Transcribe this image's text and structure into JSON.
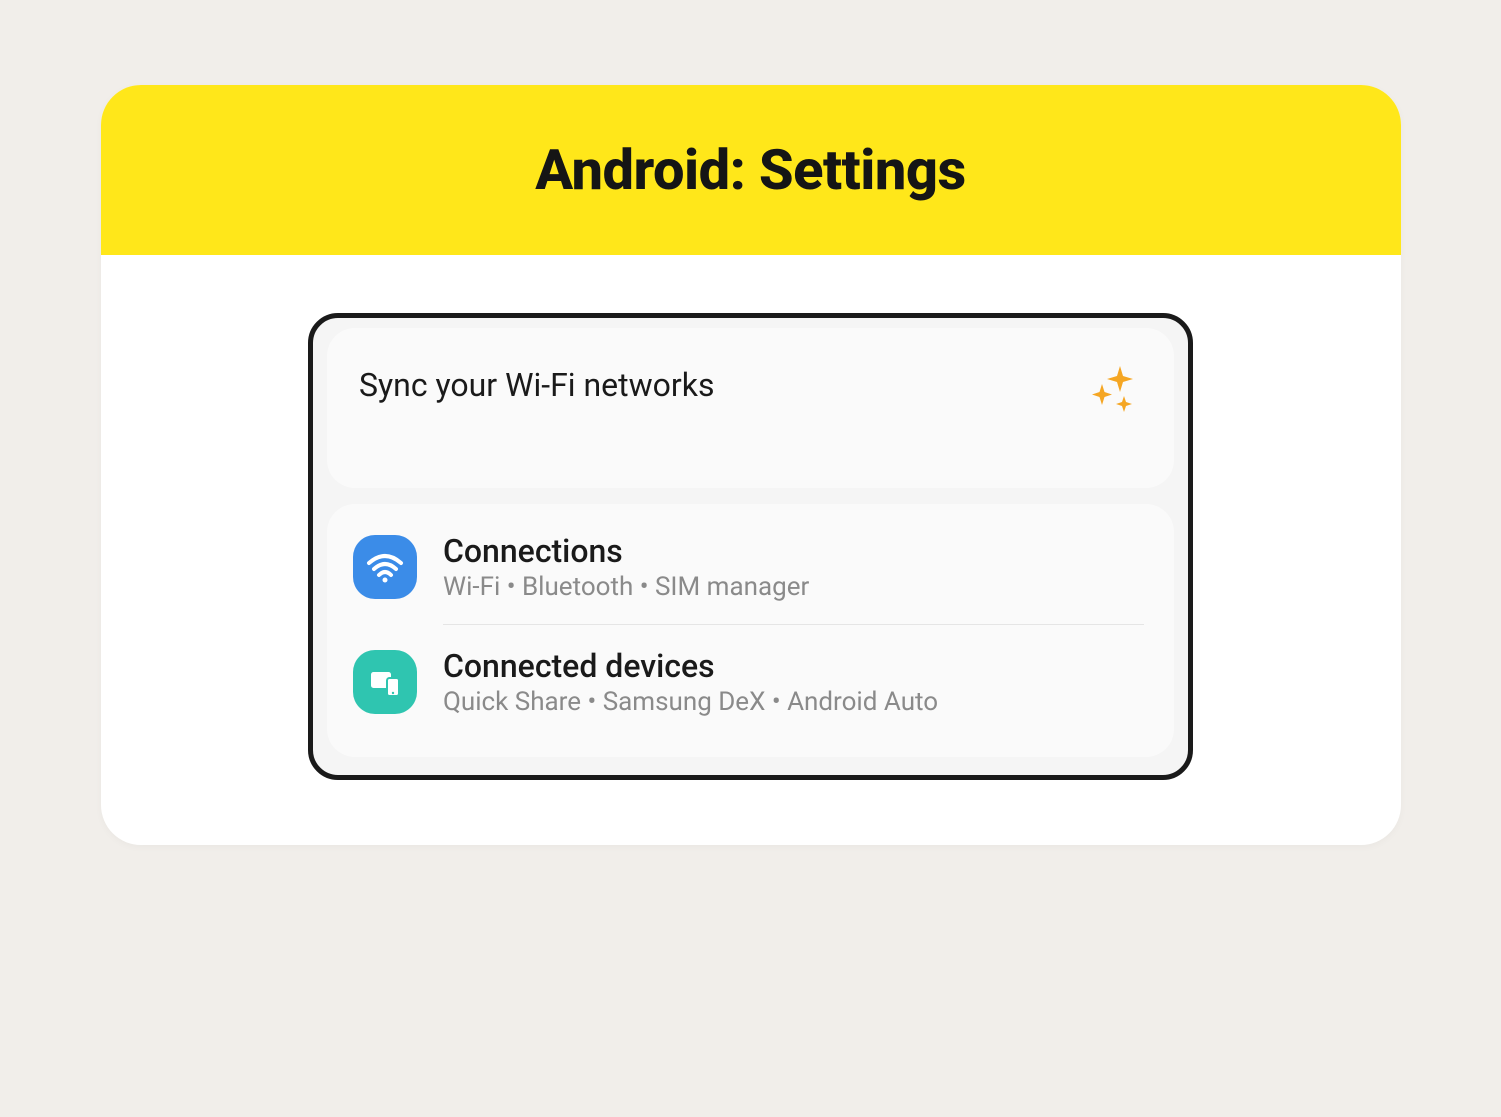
{
  "header": {
    "title": "Android: Settings"
  },
  "promo": {
    "text": "Sync your Wi-Fi networks"
  },
  "settings": {
    "items": [
      {
        "title": "Connections",
        "subtitle": "Wi-Fi  •  Bluetooth  •  SIM manager",
        "icon": "wifi",
        "iconColor": "#3b8ce8"
      },
      {
        "title": "Connected devices",
        "subtitle": "Quick Share  •  Samsung DeX  •  Android Auto",
        "icon": "devices",
        "iconColor": "#2fc5b0"
      }
    ]
  }
}
